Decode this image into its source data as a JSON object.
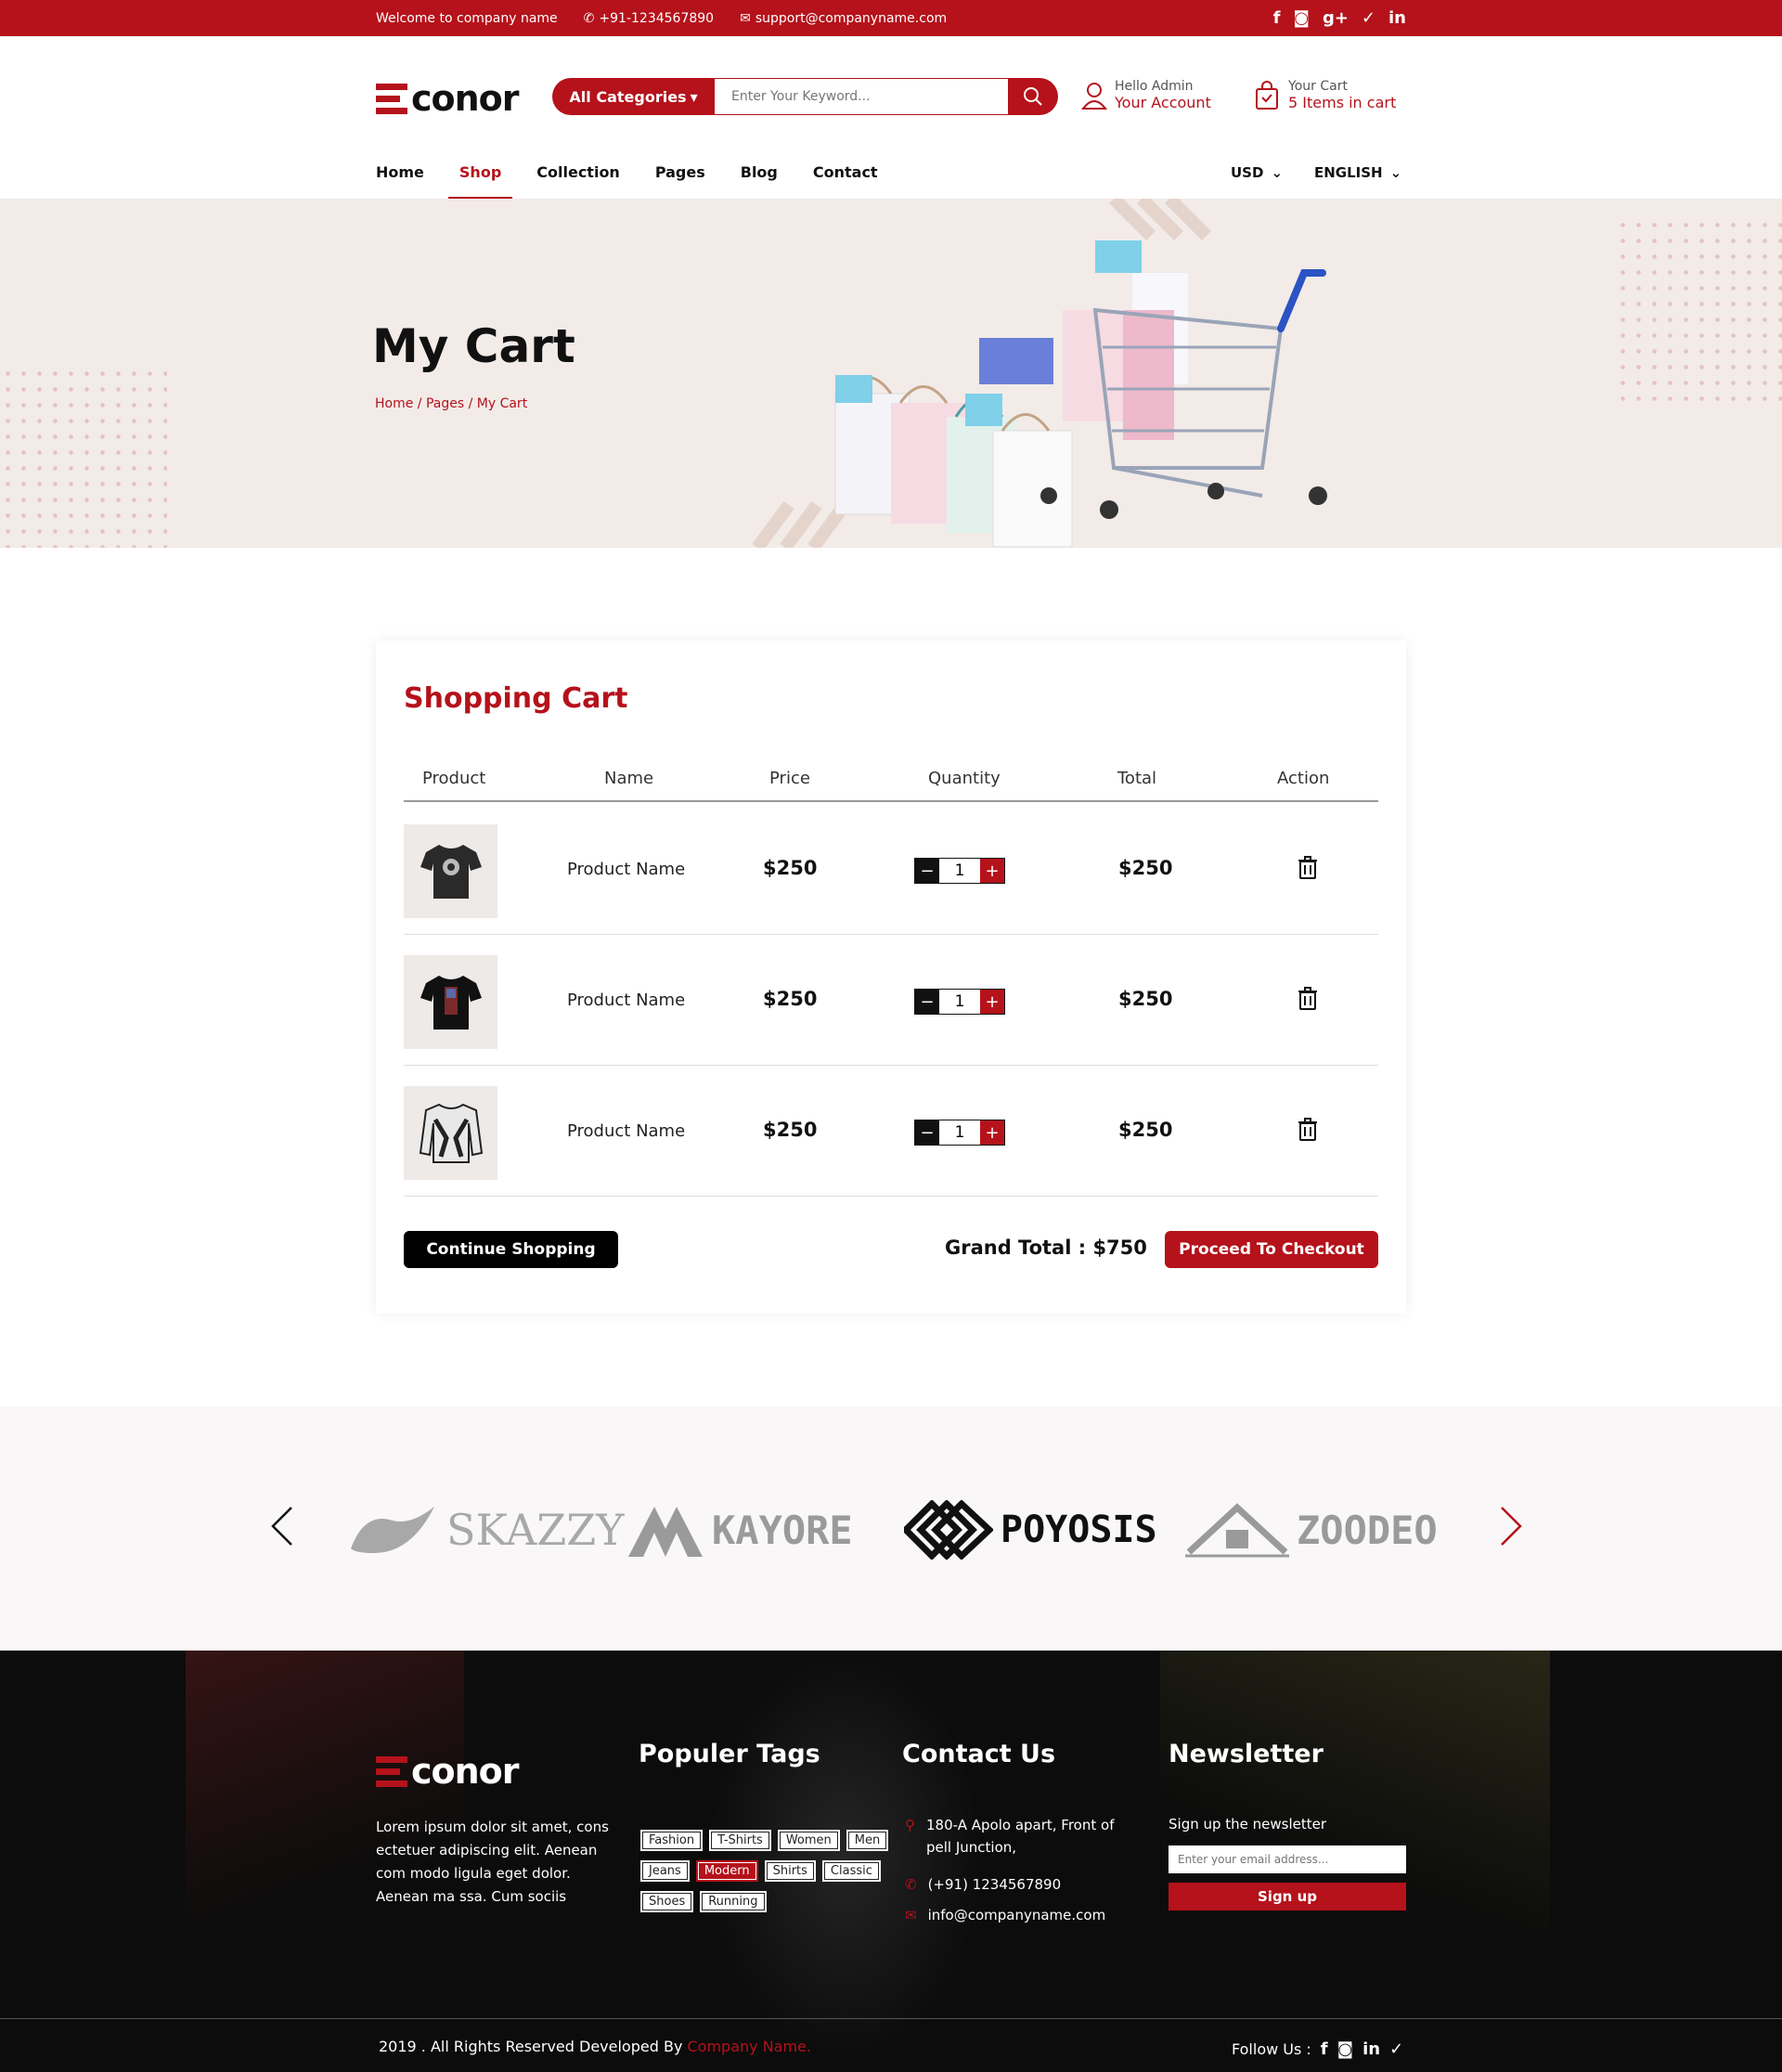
{
  "topbar": {
    "welcome": "Welcome to company name",
    "phone": "+91-1234567890",
    "email": "support@companyname.com",
    "social": [
      "f",
      "◙",
      "g+",
      "✓",
      "in"
    ]
  },
  "header": {
    "logo_text": "conor",
    "categories_label": "All Categories",
    "search_placeholder": "Enter Your Keyword...",
    "account_line1": "Hello Admin",
    "account_line2": "Your Account",
    "cart_line1": "Your Cart",
    "cart_line2": "5 Items in cart"
  },
  "nav": {
    "items": [
      "Home",
      "Shop",
      "Collection",
      "Pages",
      "Blog",
      "Contact"
    ],
    "active": "Shop",
    "currency": "USD",
    "language": "ENGLISH"
  },
  "hero": {
    "title": "My Cart",
    "breadcrumb": "Home / Pages / My Cart"
  },
  "cart": {
    "title": "Shopping Cart",
    "columns": [
      "Product",
      "Name",
      "Price",
      "Quantity",
      "Total",
      "Action"
    ],
    "rows": [
      {
        "name": "Product Name",
        "price": "$250",
        "qty": "1",
        "total": "$250"
      },
      {
        "name": "Product Name",
        "price": "$250",
        "qty": "1",
        "total": "$250"
      },
      {
        "name": "Product Name",
        "price": "$250",
        "qty": "1",
        "total": "$250"
      }
    ],
    "continue_label": "Continue Shopping",
    "grand_total": "Grand Total : $750",
    "checkout_label": "Proceed To Checkout"
  },
  "brands": [
    "SKAZZY",
    "KAYORE",
    "POYOSIS",
    "ZOODEO"
  ],
  "footer": {
    "logo_text": "conor",
    "about": "Lorem ipsum dolor sit amet, cons ectetuer adipiscing elit. Aenean com modo ligula eget dolor. Aenean ma ssa. Cum sociis",
    "tags_title": "Populer Tags",
    "tags": [
      "Fashion",
      "T-Shirts",
      "Women",
      "Men",
      "Jeans",
      "Modern",
      "Shirts",
      "Classic",
      "Shoes",
      "Running"
    ],
    "highlighted_tag": "Modern",
    "contact_title": "Contact Us",
    "address": "180-A Apolo apart, Front of pell Junction,",
    "phone": "(+91) 1234567890",
    "email": "info@companyname.com",
    "newsletter_title": "Newsletter",
    "newsletter_sub": "Sign up the newsletter",
    "newsletter_placeholder": "Enter your email address...",
    "signup_label": "Sign up",
    "copyright_prefix": "2019 . All Rights Reserved Developed By",
    "copyright_brand": "Company Name.",
    "follow_label": "Follow Us :",
    "follow_icons": [
      "f",
      "◙",
      "in",
      "✓"
    ]
  },
  "colors": {
    "accent": "#b5121b",
    "hero_bg": "#f2ebe8",
    "footer_bg": "#0c0c0c"
  }
}
